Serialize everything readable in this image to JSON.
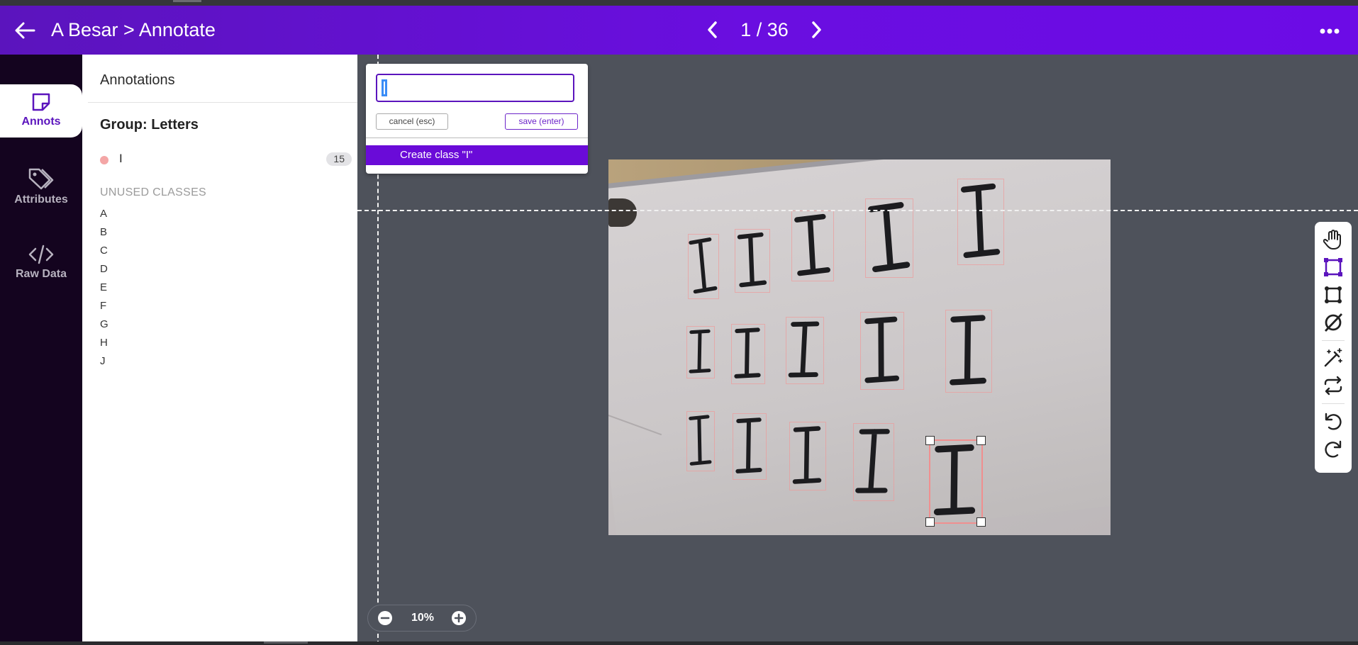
{
  "header": {
    "title": "A Besar > Annotate",
    "page_counter": "1 / 36",
    "icons": {
      "back": "arrow-left-icon",
      "prev": "chevron-left-icon",
      "next": "chevron-right-icon",
      "more": "more-horizontal-icon"
    }
  },
  "nav": {
    "items": [
      {
        "label": "Annots",
        "icon": "sticky-note-icon",
        "active": true
      },
      {
        "label": "Attributes",
        "icon": "tags-icon",
        "active": false
      },
      {
        "label": "Raw Data",
        "icon": "code-icon",
        "active": false
      }
    ]
  },
  "panel": {
    "heading": "Annotations",
    "group_title": "Group: Letters",
    "classes": [
      {
        "name": "I",
        "count": "15",
        "color": "#f4a6a6"
      }
    ],
    "unused_title": "UNUSED CLASSES",
    "unused_classes": [
      "A",
      "B",
      "C",
      "D",
      "E",
      "F",
      "G",
      "H",
      "J"
    ]
  },
  "class_popup": {
    "input_value": "",
    "cancel_label": "cancel (esc)",
    "save_label": "save (enter)",
    "create_label": "Create class \"I\""
  },
  "toolbar": {
    "tools": [
      "hand-pan-icon",
      "bounding-box-icon",
      "polygon-icon",
      "no-class-icon",
      "magic-wand-icon",
      "repeat-icon",
      "undo-icon",
      "redo-icon"
    ],
    "active_tool": "bounding-box-icon"
  },
  "zoom": {
    "value": "10%",
    "icons": {
      "out": "zoom-out-icon",
      "in": "zoom-in-icon"
    }
  },
  "colors": {
    "brand": "#6a0ee0",
    "nav_bg": "#14041f",
    "annotation": "#f4a6a6"
  }
}
